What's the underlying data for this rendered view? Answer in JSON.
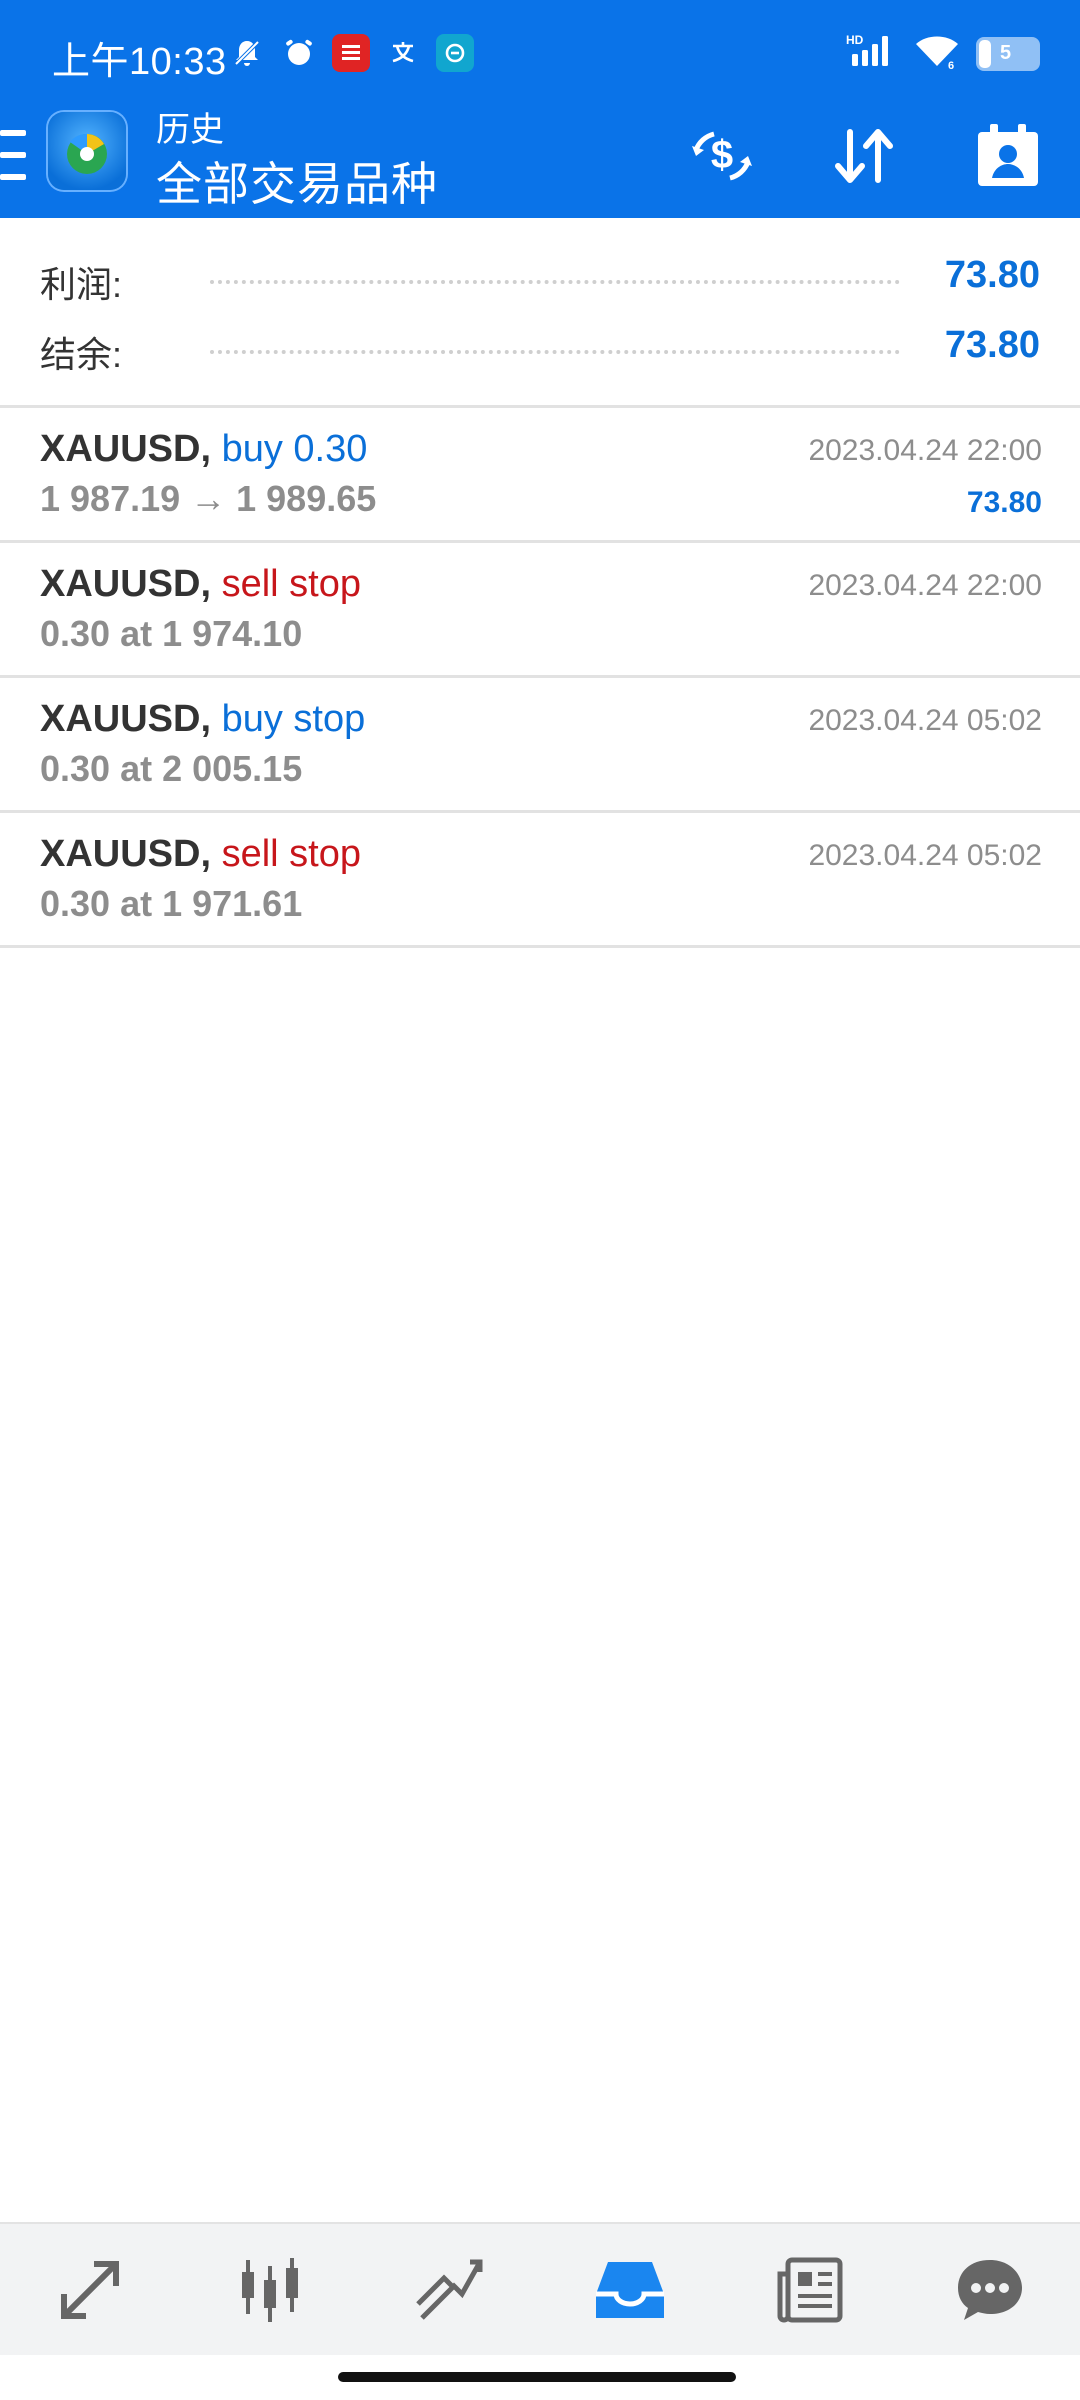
{
  "status_bar": {
    "time": "上午10:33",
    "battery": "5",
    "network": "HD"
  },
  "header": {
    "title": "历史",
    "subtitle": "全部交易品种"
  },
  "summary": {
    "profit_label": "利润:",
    "profit_value": "73.80",
    "balance_label": "结余:",
    "balance_value": "73.80"
  },
  "trades": [
    {
      "symbol": "XAUUSD,",
      "type": "buy 0.30",
      "type_color": "#0a6fd8",
      "detail": "1 987.19 → 1 989.65",
      "time": "2023.04.24 22:00",
      "profit": "73.80"
    },
    {
      "symbol": "XAUUSD,",
      "type": "sell stop",
      "type_color": "#c7161b",
      "detail": "0.30 at 1 974.10",
      "time": "2023.04.24 22:00",
      "profit": ""
    },
    {
      "symbol": "XAUUSD,",
      "type": "buy stop",
      "type_color": "#0a6fd8",
      "detail": "0.30 at 2 005.15",
      "time": "2023.04.24 05:02",
      "profit": ""
    },
    {
      "symbol": "XAUUSD,",
      "type": "sell stop",
      "type_color": "#c7161b",
      "detail": "0.30 at 1 971.61",
      "time": "2023.04.24 05:02",
      "profit": ""
    }
  ],
  "bottom_nav": [
    {
      "icon": "quotes-icon",
      "active": false
    },
    {
      "icon": "chart-icon",
      "active": false
    },
    {
      "icon": "trade-icon",
      "active": false
    },
    {
      "icon": "history-icon",
      "active": true
    },
    {
      "icon": "news-icon",
      "active": false
    },
    {
      "icon": "chat-icon",
      "active": false
    }
  ],
  "colors": {
    "header_bg": "#0a73e8",
    "accent_blue": "#0a6fd8",
    "sell_red": "#c7161b",
    "muted_gray": "#8d8d8d",
    "nav_active": "#1a86f0",
    "nav_inactive": "#666666"
  }
}
